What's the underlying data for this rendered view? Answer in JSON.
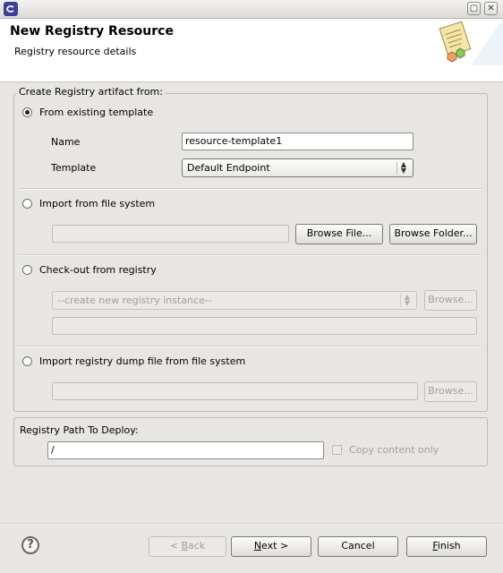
{
  "window": {
    "minimize_glyph": "▢",
    "close_glyph": "✕"
  },
  "banner": {
    "title": "New Registry Resource",
    "subtitle": "Registry resource details"
  },
  "create_group": {
    "legend": "Create Registry artifact from:",
    "from_template": {
      "label": "From existing template",
      "selected": true
    },
    "name_label": "Name",
    "name_value": "resource-template1",
    "template_label": "Template",
    "template_value": "Default Endpoint",
    "import_fs": {
      "label": "Import from file system",
      "selected": false
    },
    "import_fs_path": "",
    "browse_file": "Browse File...",
    "browse_folder": "Browse Folder...",
    "checkout": {
      "label": "Check-out from registry",
      "selected": false
    },
    "registry_select": "--create new registry instance--",
    "browse": "Browse...",
    "checkout_path": "",
    "dump": {
      "label": "Import registry dump file from file system",
      "selected": false
    },
    "dump_path": "",
    "browse2": "Browse..."
  },
  "deploy_group": {
    "label": "Registry Path To Deploy:",
    "path_value": "/",
    "copy_content_label": "Copy content only"
  },
  "footer": {
    "help": "?",
    "back": {
      "mnemonic": "B",
      "rest": "ack",
      "prefix": "< "
    },
    "next": {
      "mnemonic": "N",
      "rest": "ext >"
    },
    "cancel": "Cancel",
    "finish": {
      "mnemonic": "F",
      "rest": "inish"
    }
  }
}
